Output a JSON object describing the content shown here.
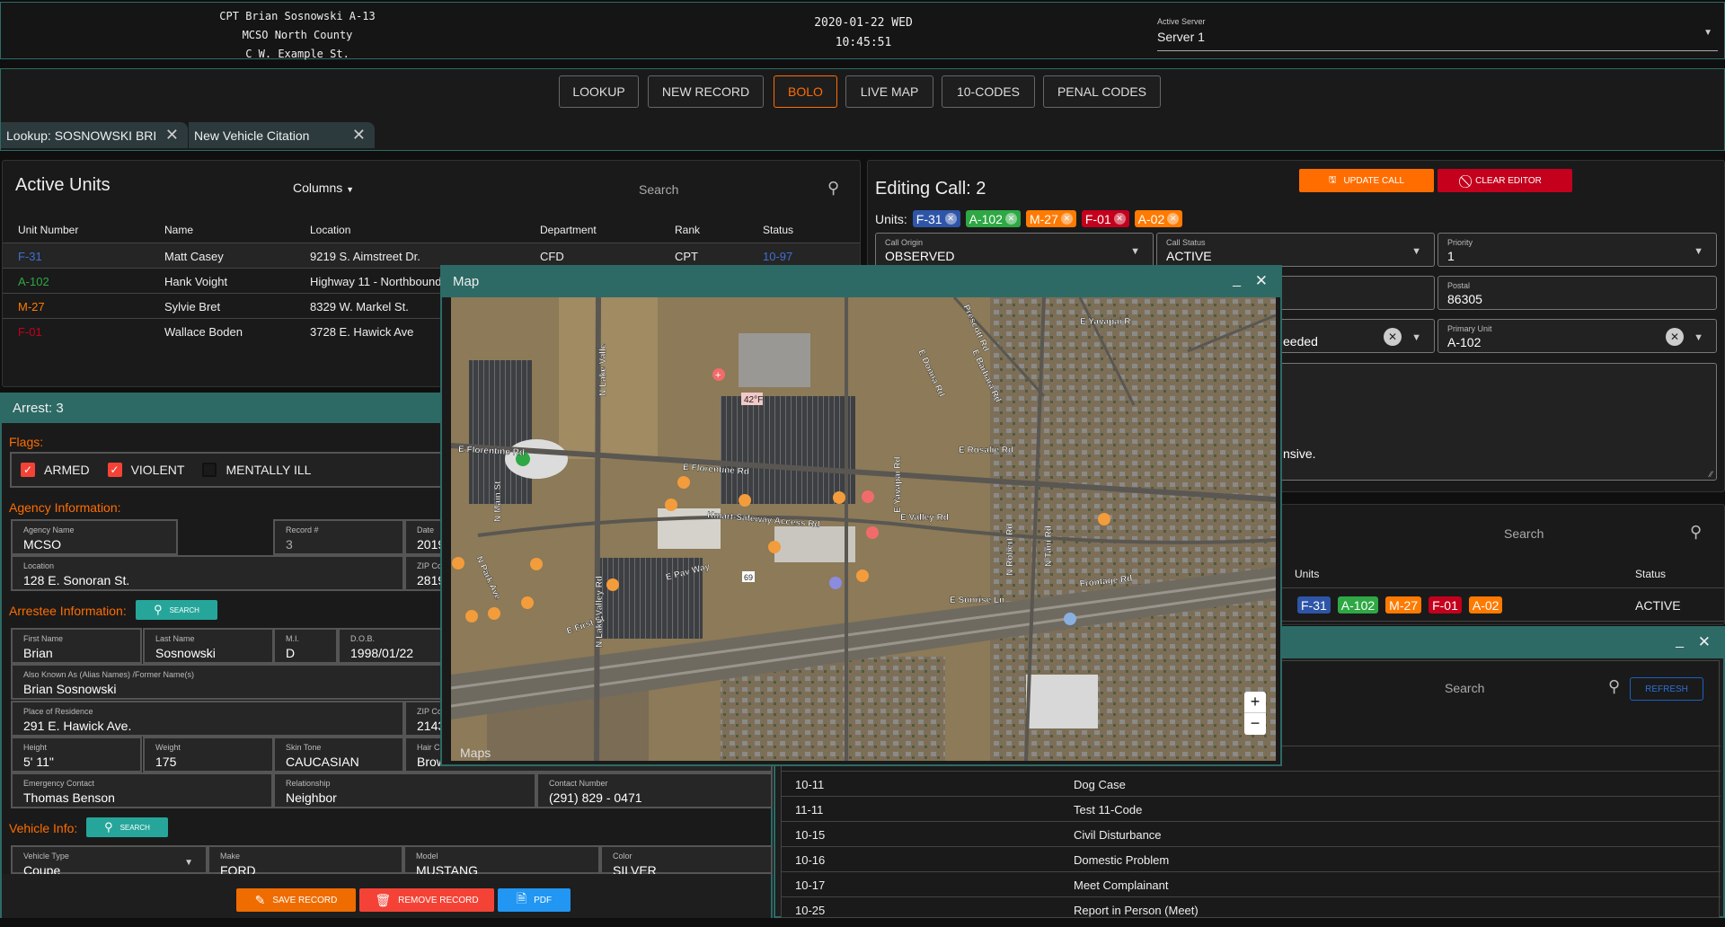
{
  "header": {
    "officer": "CPT Brian Sosnowski A-13",
    "agency": "MCSO North County",
    "location": "C W. Example St.",
    "date": "2020-01-22 WED",
    "time": "10:45:51",
    "server_label": "Active Server",
    "server_value": "Server 1"
  },
  "nav": {
    "buttons": [
      "LOOKUP",
      "NEW RECORD",
      "BOLO",
      "LIVE MAP",
      "10-CODES",
      "PENAL CODES"
    ],
    "active": "BOLO"
  },
  "tabs": [
    {
      "label": "Lookup: SOSNOWSKI BRI"
    },
    {
      "label": "New Vehicle Citation"
    }
  ],
  "active_units": {
    "title": "Active Units",
    "columns_label": "Columns",
    "search_placeholder": "Search",
    "headers": [
      "Unit Number",
      "Name",
      "Location",
      "Department",
      "Rank",
      "Status"
    ],
    "rows": [
      {
        "unit": "F-31",
        "color": "#3f6fd0",
        "name": "Matt Casey",
        "location": "9219 S. Aimstreet Dr.",
        "department": "CFD",
        "rank": "CPT",
        "status": "10-97"
      },
      {
        "unit": "A-102",
        "color": "#2ea844",
        "name": "Hank Voight",
        "location": "Highway 11 - Northbound",
        "department": "",
        "rank": "",
        "status": ""
      },
      {
        "unit": "M-27",
        "color": "#ff7a00",
        "name": "Sylvie Bret",
        "location": "8329 W. Markel St.",
        "department": "",
        "rank": "",
        "status": ""
      },
      {
        "unit": "F-01",
        "color": "#c4001d",
        "name": "Wallace Boden",
        "location": "3728 E. Hawick Ave",
        "department": "",
        "rank": "",
        "status": ""
      }
    ]
  },
  "editing_call": {
    "title": "Editing Call: 2",
    "update_label": "UPDATE CALL",
    "clear_label": "CLEAR EDITOR",
    "units_label": "Units:",
    "units": [
      {
        "id": "F-31",
        "color": "#2e55a8"
      },
      {
        "id": "A-102",
        "color": "#2ea844"
      },
      {
        "id": "M-27",
        "color": "#ff7a00"
      },
      {
        "id": "F-01",
        "color": "#c4001d"
      },
      {
        "id": "A-02",
        "color": "#ff7a00"
      }
    ],
    "call_origin": {
      "label": "Call Origin",
      "value": "OBSERVED"
    },
    "call_status": {
      "label": "Call Status",
      "value": "ACTIVE"
    },
    "priority": {
      "label": "Priority",
      "value": "1"
    },
    "postal": {
      "label": "Postal",
      "value": "86305"
    },
    "partial_field_value": "eeded",
    "primary_unit": {
      "label": "Primary Unit",
      "value": "A-102"
    },
    "notes_partial": "nsive."
  },
  "calls_table": {
    "search_placeholder": "Search",
    "headers": [
      "Units",
      "Status"
    ],
    "row": {
      "units": [
        "F-31",
        "A-102",
        "M-27",
        "F-01",
        "A-02"
      ],
      "status": "ACTIVE"
    }
  },
  "ten_codes": {
    "search_placeholder": "Search",
    "refresh_label": "REFRESH",
    "rows": [
      {
        "code": "10-11",
        "desc": "Dog Case"
      },
      {
        "code": "11-11",
        "desc": "Test 11-Code"
      },
      {
        "code": "10-15",
        "desc": "Civil Disturbance"
      },
      {
        "code": "10-16",
        "desc": "Domestic Problem"
      },
      {
        "code": "10-17",
        "desc": "Meet Complainant"
      },
      {
        "code": "10-25",
        "desc": "Report in Person (Meet)"
      }
    ]
  },
  "arrest": {
    "title": "Arrest: 3",
    "flags_label": "Flags:",
    "flags": [
      {
        "label": "ARMED",
        "checked": true
      },
      {
        "label": "VIOLENT",
        "checked": true
      },
      {
        "label": "MENTALLY ILL",
        "checked": false
      }
    ],
    "agency_label": "Agency Information:",
    "agency_name": {
      "label": "Agency Name",
      "value": "MCSO"
    },
    "record": {
      "label": "Record #",
      "value": "3"
    },
    "date": {
      "label": "Date",
      "value": "2019"
    },
    "location": {
      "label": "Location",
      "value": "128 E. Sonoran St."
    },
    "zip1": {
      "label": "ZIP Co",
      "value": "2819"
    },
    "arrestee_label": "Arrestee Information:",
    "search_label": "SEARCH",
    "first": {
      "label": "First Name",
      "value": "Brian"
    },
    "last": {
      "label": "Last Name",
      "value": "Sosnowski"
    },
    "mi": {
      "label": "M.I.",
      "value": "D"
    },
    "dob": {
      "label": "D.O.B.",
      "value": "1998/01/22"
    },
    "aka": {
      "label": "Also Known As (Alias Names) /Former Name(s)",
      "value": "Brian Sosnowski"
    },
    "residence": {
      "label": "Place of Residence",
      "value": "291 E. Hawick Ave."
    },
    "zip2": {
      "label": "ZIP Co",
      "value": "2143"
    },
    "height": {
      "label": "Height",
      "value": "5' 11\""
    },
    "weight": {
      "label": "Weight",
      "value": "175"
    },
    "skin": {
      "label": "Skin Tone",
      "value": "CAUCASIAN"
    },
    "hair": {
      "label": "Hair Co",
      "value": "Brow"
    },
    "emergency": {
      "label": "Emergency Contact",
      "value": "Thomas Benson"
    },
    "relationship": {
      "label": "Relationship",
      "value": "Neighbor"
    },
    "contact": {
      "label": "Contact Number",
      "value": "(291) 829 - 0471"
    },
    "vehicle_label": "Vehicle Info:",
    "vtype": {
      "label": "Vehicle Type",
      "value": "Coupe"
    },
    "make": {
      "label": "Make",
      "value": "FORD"
    },
    "model": {
      "label": "Model",
      "value": "MUSTANG"
    },
    "color": {
      "label": "Color",
      "value": "SILVER"
    },
    "save_label": "SAVE RECORD",
    "remove_label": "REMOVE RECORD",
    "pdf_label": "PDF"
  },
  "map": {
    "title": "Map",
    "attribution": "Maps",
    "temperature": "42°F",
    "route": "69",
    "zoom_in": "+",
    "zoom_out": "−",
    "streets": [
      "N Lake Valle",
      "E Florentine Rd",
      "E Florentine Rd",
      "Kmart-Safeway Access Rd",
      "E Pav Way",
      "E First St",
      "Frontage Rd",
      "E Valley Rd",
      "E Rosalie Rd",
      "E Yavapai R",
      "E Donna Rd",
      "E Barbara Rd",
      "Prescott Rd",
      "N Main St",
      "N Park Ave",
      "E Sunrise Ln",
      "N Robert Rd",
      "N Tani Rd",
      "N Lake Valley Rd",
      "E Yavapai Rd"
    ]
  },
  "colors": {
    "accent_teal": "#2d6a65",
    "orange": "#ff6d00",
    "red": "#c4001d",
    "blue": "#2e55a8",
    "green": "#2ea844"
  }
}
